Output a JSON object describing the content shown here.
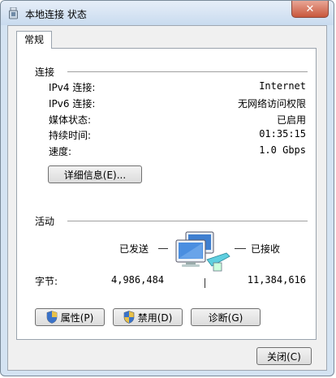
{
  "window": {
    "title": "本地连接 状态",
    "close_symbol": "✕"
  },
  "tabs": [
    {
      "label": "常规"
    }
  ],
  "connection": {
    "section_title": "连接",
    "rows": [
      {
        "label": "IPv4 连接:",
        "value": "Internet"
      },
      {
        "label": "IPv6 连接:",
        "value": "无网络访问权限"
      },
      {
        "label": "媒体状态:",
        "value": "已启用"
      },
      {
        "label": "持续时间:",
        "value": "01:35:15"
      },
      {
        "label": "速度:",
        "value": "1.0 Gbps"
      }
    ],
    "details_button": "详细信息(E)..."
  },
  "activity": {
    "section_title": "活动",
    "sent_label": "已发送",
    "received_label": "已接收",
    "bytes_label": "字节:",
    "bytes_sent": "4,986,484",
    "bytes_received": "11,384,616"
  },
  "buttons": {
    "properties": "属性(P)",
    "disable": "禁用(D)",
    "diagnose": "诊断(G)",
    "close": "关闭(C)"
  },
  "icons": {
    "title": "network-adapter-icon",
    "network": "network-computers-icon",
    "shield": "uac-shield-icon"
  }
}
